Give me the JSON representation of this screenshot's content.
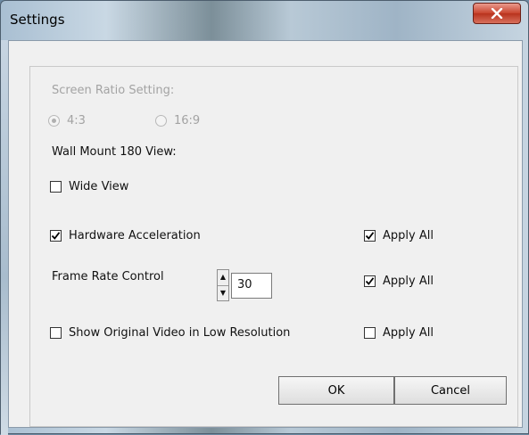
{
  "window": {
    "title": "Settings",
    "close_label": "x"
  },
  "screen_ratio": {
    "label": "Screen Ratio Setting:",
    "options": [
      {
        "label": "4:3",
        "selected": true
      },
      {
        "label": "16:9",
        "selected": false
      }
    ]
  },
  "wall_mount": {
    "label": "Wall Mount 180 View:",
    "wide_view_label": "Wide View",
    "wide_view_checked": false
  },
  "hardware_acceleration": {
    "label": "Hardware Acceleration",
    "checked": true,
    "apply_all_label": "Apply All",
    "apply_all_checked": true
  },
  "frame_rate": {
    "label": "Frame Rate Control",
    "value": "30",
    "apply_all_label": "Apply All",
    "apply_all_checked": true
  },
  "low_res": {
    "label": "Show Original Video in Low Resolution",
    "checked": false,
    "apply_all_label": "Apply All",
    "apply_all_checked": false
  },
  "buttons": {
    "ok": "OK",
    "cancel": "Cancel"
  }
}
